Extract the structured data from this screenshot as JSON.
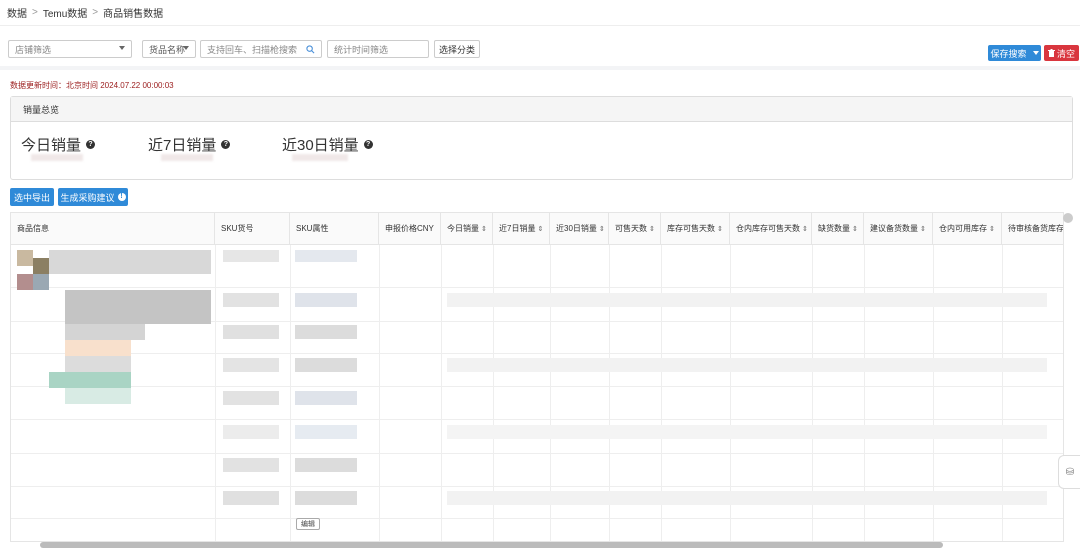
{
  "breadcrumb": {
    "items": [
      "数据",
      "Temu数据",
      "商品销售数据"
    ],
    "separator": ">"
  },
  "filters": {
    "store_placeholder": "店铺筛选",
    "goods_field": "货品名称",
    "search_placeholder": "支持回车、扫描枪搜索",
    "time_placeholder": "统计时间筛选",
    "category_button": "选择分类",
    "save_search": "保存搜索",
    "clear": "清空"
  },
  "update_time": "数据更新时间：北京时间 2024.07.22 00:00:03",
  "overview": {
    "title": "销量总览",
    "metrics": [
      "今日销量",
      "近7日销量",
      "近30日销量"
    ]
  },
  "actions": {
    "export": "选中导出",
    "purchase": "生成采购建议"
  },
  "table": {
    "columns": [
      "商品信息",
      "SKU货号",
      "SKU属性",
      "申报价格CNY",
      "今日销量",
      "近7日销量",
      "近30日销量",
      "可售天数",
      "库存可售天数",
      "仓内库存可售天数",
      "缺货数量",
      "建议备货数量",
      "仓内可用库存",
      "待审核备货库存"
    ],
    "sortable": [
      false,
      false,
      false,
      false,
      true,
      true,
      true,
      true,
      true,
      true,
      true,
      true,
      true,
      false
    ]
  },
  "tooltip_text": "编辑",
  "colors": {
    "primary": "#2f8ad8",
    "danger": "#d9363e",
    "update_text": "#9b1c1c"
  }
}
